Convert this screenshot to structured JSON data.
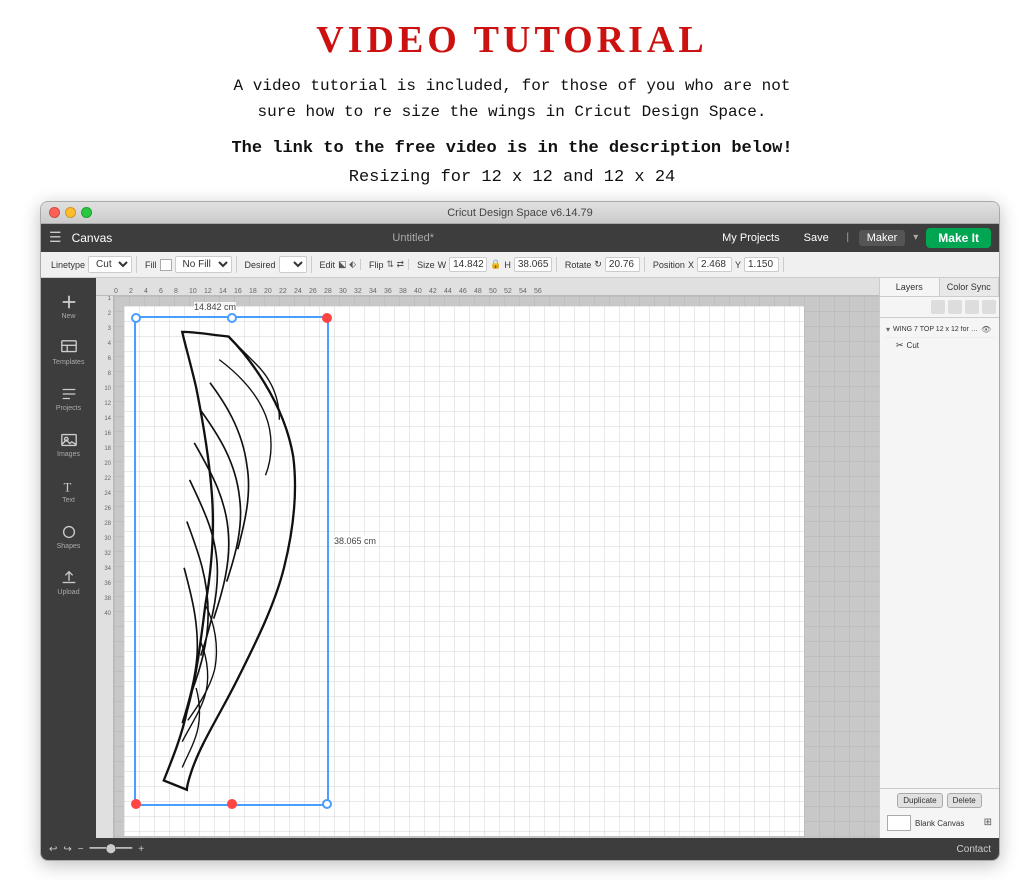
{
  "header": {
    "title": "VIDEO TUTORIAL",
    "subtitle_line1": "A video tutorial is included, for those of you who are not",
    "subtitle_line2": "sure how to re size the wings in Cricut Design Space.",
    "link_line": "The link to the free video is in the description below!",
    "resize_line": "Resizing for 12 x 12 and 12 x 24"
  },
  "window": {
    "title_bar_text": "Cricut Design Space v6.14.79",
    "tab_title": "Untitled*"
  },
  "menubar": {
    "canvas_label": "Canvas",
    "my_projects": "My Projects",
    "save": "Save",
    "maker_label": "Maker",
    "make_it": "Make It"
  },
  "toolbar": {
    "linetype_label": "Linetype",
    "cut_label": "Cut",
    "fill_label": "Fill",
    "no_fill_label": "No Fill",
    "desired_label": "Desired",
    "edit_label": "Edit",
    "flip_label": "Flip",
    "size_label": "Size",
    "w_value": "14.842",
    "h_value": "38.065",
    "rotate_label": "Rotate",
    "rotate_value": "20.76",
    "position_label": "Position",
    "x_value": "2.468",
    "y_value": "1.150"
  },
  "canvas": {
    "size_h_label": "14.842 cm",
    "size_v_label": "38.065 cm"
  },
  "layers": {
    "tab1": "Layers",
    "tab2": "Color Sync",
    "layer1_name": "WING 7 TOP 12 x 12 for cri...",
    "layer1_type": "Cut",
    "duplicate_btn": "Duplicate",
    "delete_btn": "Delete",
    "blank_canvas": "Blank Canvas"
  },
  "bottombar": {
    "undo_label": "↩",
    "redo_label": "↪",
    "contact_label": "Contact"
  }
}
